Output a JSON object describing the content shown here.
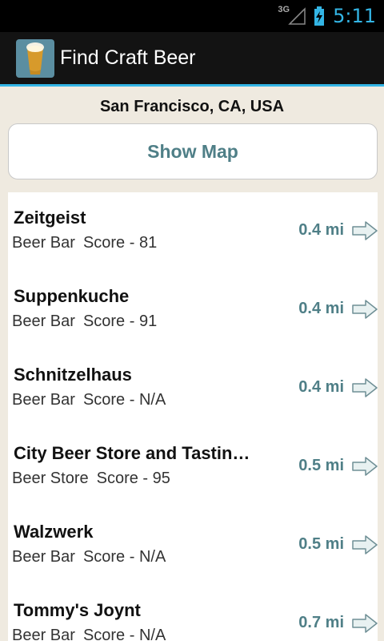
{
  "status_bar": {
    "network": "3G",
    "time": "5:11"
  },
  "action_bar": {
    "app_icon": "beer-glass-icon",
    "title": "Find Craft Beer"
  },
  "location": "San Francisco, CA, USA",
  "map_button": "Show Map",
  "colors": {
    "accent": "#33b5e5",
    "teal_text": "#4f7f87",
    "background": "#efeae0"
  },
  "bars": [
    {
      "name": "Zeitgeist",
      "type": "Beer Bar",
      "score": "Score - 81",
      "distance": "0.4 mi"
    },
    {
      "name": "Suppenkuche",
      "type": "Beer Bar",
      "score": "Score - 91",
      "distance": "0.4 mi"
    },
    {
      "name": "Schnitzelhaus",
      "type": "Beer Bar",
      "score": "Score - N/A",
      "distance": "0.4 mi"
    },
    {
      "name": "City Beer Store and Tastin…",
      "type": "Beer Store",
      "score": "Score - 95",
      "distance": "0.5 mi"
    },
    {
      "name": "Walzwerk",
      "type": "Beer Bar",
      "score": "Score - N/A",
      "distance": "0.5 mi"
    },
    {
      "name": "Tommy's Joynt",
      "type": "Beer Bar",
      "score": "Score - N/A",
      "distance": "0.7 mi"
    }
  ]
}
